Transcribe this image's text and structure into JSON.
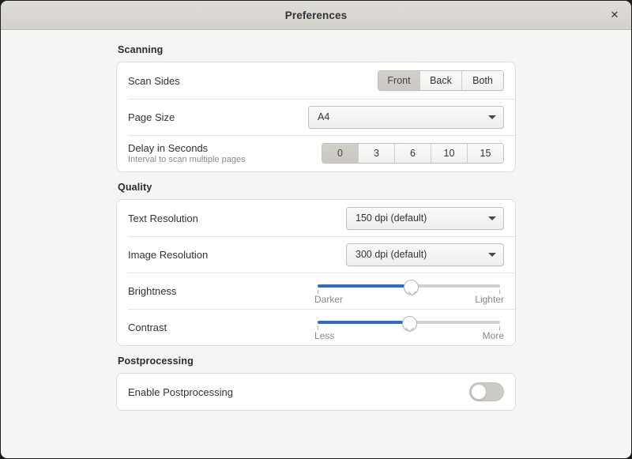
{
  "window": {
    "title": "Preferences",
    "close_label": "✕"
  },
  "sections": [
    {
      "title": "Scanning",
      "rows": [
        {
          "label": "Scan Sides",
          "control": "segmented",
          "options": [
            "Front",
            "Back",
            "Both"
          ],
          "selected": "Front"
        },
        {
          "label": "Page Size",
          "control": "dropdown",
          "value": "A4"
        },
        {
          "label": "Delay in Seconds",
          "sublabel": "Interval to scan multiple pages",
          "control": "segmented",
          "options": [
            "0",
            "3",
            "6",
            "10",
            "15"
          ],
          "selected": "0"
        }
      ]
    },
    {
      "title": "Quality",
      "rows": [
        {
          "label": "Text Resolution",
          "control": "dropdown",
          "value": "150 dpi (default)"
        },
        {
          "label": "Image Resolution",
          "control": "dropdown",
          "value": "300 dpi (default)"
        },
        {
          "label": "Brightness",
          "control": "slider",
          "min_label": "Darker",
          "max_label": "Lighter",
          "percent": 51
        },
        {
          "label": "Contrast",
          "control": "slider",
          "min_label": "Less",
          "max_label": "More",
          "percent": 50
        }
      ]
    },
    {
      "title": "Postprocessing",
      "rows": [
        {
          "label": "Enable Postprocessing",
          "control": "toggle",
          "state": "off"
        }
      ]
    }
  ],
  "colors": {
    "accent": "#2d6ec4",
    "window_bg": "#f6f5f4",
    "card_bg": "#ffffff",
    "titlebar_bg": "#dcd9d5",
    "selected_segment": "#cfcbc6"
  }
}
